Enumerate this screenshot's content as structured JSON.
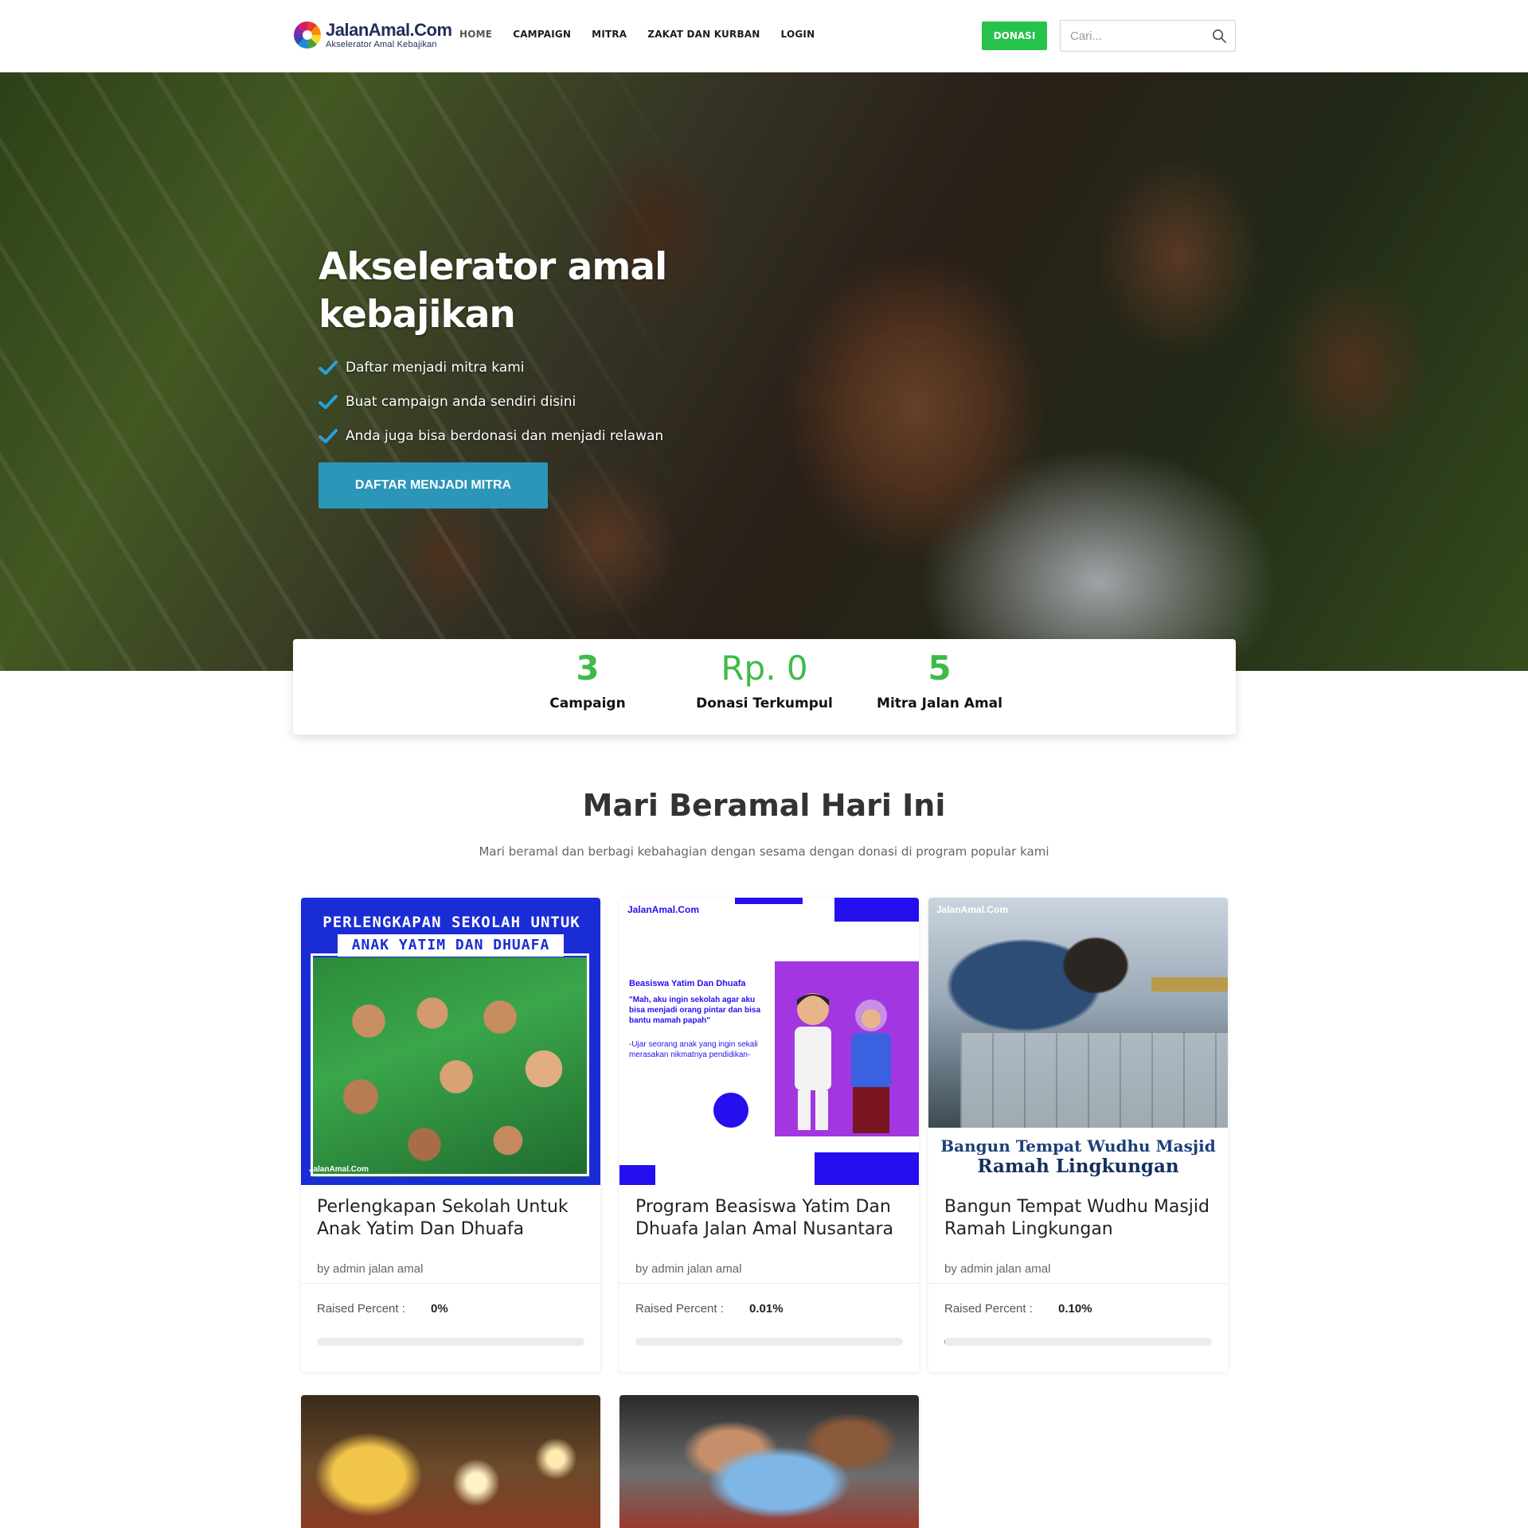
{
  "brand": {
    "name": "JalanAmal.Com",
    "tagline": "Akselerator Amal Kebajikan"
  },
  "nav": {
    "items": [
      {
        "label": "HOME"
      },
      {
        "label": "CAMPAIGN"
      },
      {
        "label": "MITRA"
      },
      {
        "label": "ZAKAT DAN KURBAN"
      },
      {
        "label": "LOGIN"
      }
    ],
    "donate_label": "DONASI",
    "search_placeholder": "Cari..."
  },
  "hero": {
    "title": "Akselerator amal kebajikan",
    "points": [
      "Daftar menjadi mitra kami",
      "Buat campaign anda sendiri disini",
      "Anda juga bisa berdonasi dan menjadi relawan"
    ],
    "cta_label": "DAFTAR MENJADI MITRA"
  },
  "stats": [
    {
      "value": "3",
      "label": "Campaign"
    },
    {
      "value": "Rp. 0",
      "label": "Donasi Terkumpul"
    },
    {
      "value": "5",
      "label": "Mitra Jalan Amal"
    }
  ],
  "section": {
    "title": "Mari Beramal Hari Ini",
    "subtitle": "Mari beramal dan berbagi kebahagian dengan sesama dengan donasi di program popular kami"
  },
  "campaigns": [
    {
      "title": "Perlengkapan Sekolah Untuk Anak Yatim Dan Dhuafa",
      "author": "by admin jalan amal",
      "raised_label": "Raised Percent :",
      "raised_value": "0%",
      "raised_fraction": 0,
      "image_text": {
        "line1": "PERLENGKAPAN SEKOLAH UNTUK",
        "line2": "ANAK YATIM DAN DHUAFA",
        "logo": "JalanAmal.Com"
      }
    },
    {
      "title": "Program Beasiswa Yatim Dan Dhuafa Jalan Amal Nusantara",
      "author": "by admin jalan amal",
      "raised_label": "Raised Percent :",
      "raised_value": "0.01%",
      "raised_fraction": 0.0001,
      "image_text": {
        "logo": "JalanAmal.Com",
        "heading": "Beasiswa Yatim Dan Dhuafa",
        "quote": "\"Mah, aku ingin sekolah agar aku bisa menjadi orang pintar dan bisa bantu mamah papah\"",
        "footer": "-Ujar seorang anak yang ingin sekali merasakan nikmatnya pendidikan-"
      }
    },
    {
      "title": "Bangun Tempat Wudhu Masjid Ramah Lingkungan",
      "author": "by admin jalan amal",
      "raised_label": "Raised Percent :",
      "raised_value": "0.10%",
      "raised_fraction": 0.001,
      "image_text": {
        "logo": "JalanAmal.Com",
        "line1": "Bangun Tempat Wudhu Masjid",
        "line2": "Ramah Lingkungan"
      }
    }
  ],
  "colors": {
    "accent_green": "#3dbb48",
    "donate_green": "#27c24c",
    "hero_button": "#2b96b8",
    "brand_navy": "#232f5c"
  }
}
